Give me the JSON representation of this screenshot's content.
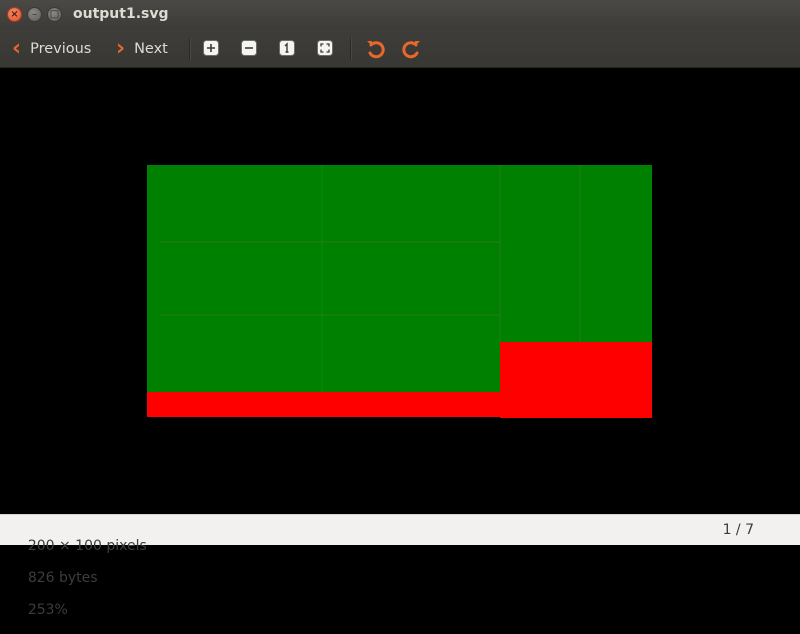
{
  "window": {
    "title": "output1.svg",
    "close_glyph": "×",
    "minimize_glyph": "–",
    "maximize_glyph": "□"
  },
  "toolbar": {
    "previous_label": "Previous",
    "next_label": "Next",
    "icons": [
      "zoom-in-icon",
      "zoom-out-icon",
      "zoom-1to1-icon",
      "zoom-fit-icon",
      "rotate-left-icon",
      "rotate-right-icon"
    ]
  },
  "image": {
    "colors": {
      "green": "#008000",
      "red": "#ff0000",
      "background": "#000000"
    }
  },
  "status": {
    "dimensions": "200 × 100 pixels",
    "size": "826 bytes",
    "zoom": "253%",
    "page": "1 / 7"
  }
}
